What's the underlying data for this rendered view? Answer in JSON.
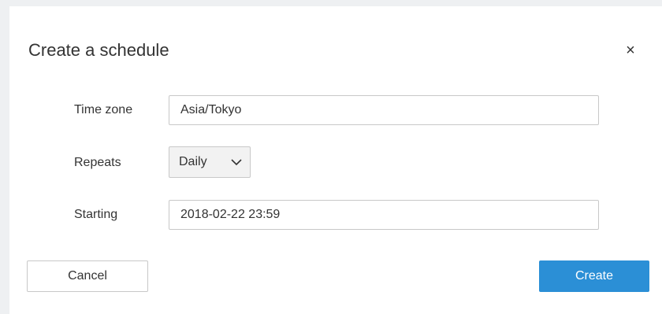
{
  "dialog": {
    "title": "Create a schedule",
    "close_glyph": "×"
  },
  "form": {
    "time_zone": {
      "label": "Time zone",
      "value": "Asia/Tokyo"
    },
    "repeats": {
      "label": "Repeats",
      "selected": "Daily"
    },
    "starting": {
      "label": "Starting",
      "value": "2018-02-22 23:59"
    }
  },
  "actions": {
    "cancel_label": "Cancel",
    "create_label": "Create"
  },
  "colors": {
    "primary": "#2b8fd6",
    "background": "#eef0f2",
    "border": "#c8c8c8"
  },
  "icons": {
    "close": "close-icon",
    "dropdown": "chevron-down-icon"
  }
}
